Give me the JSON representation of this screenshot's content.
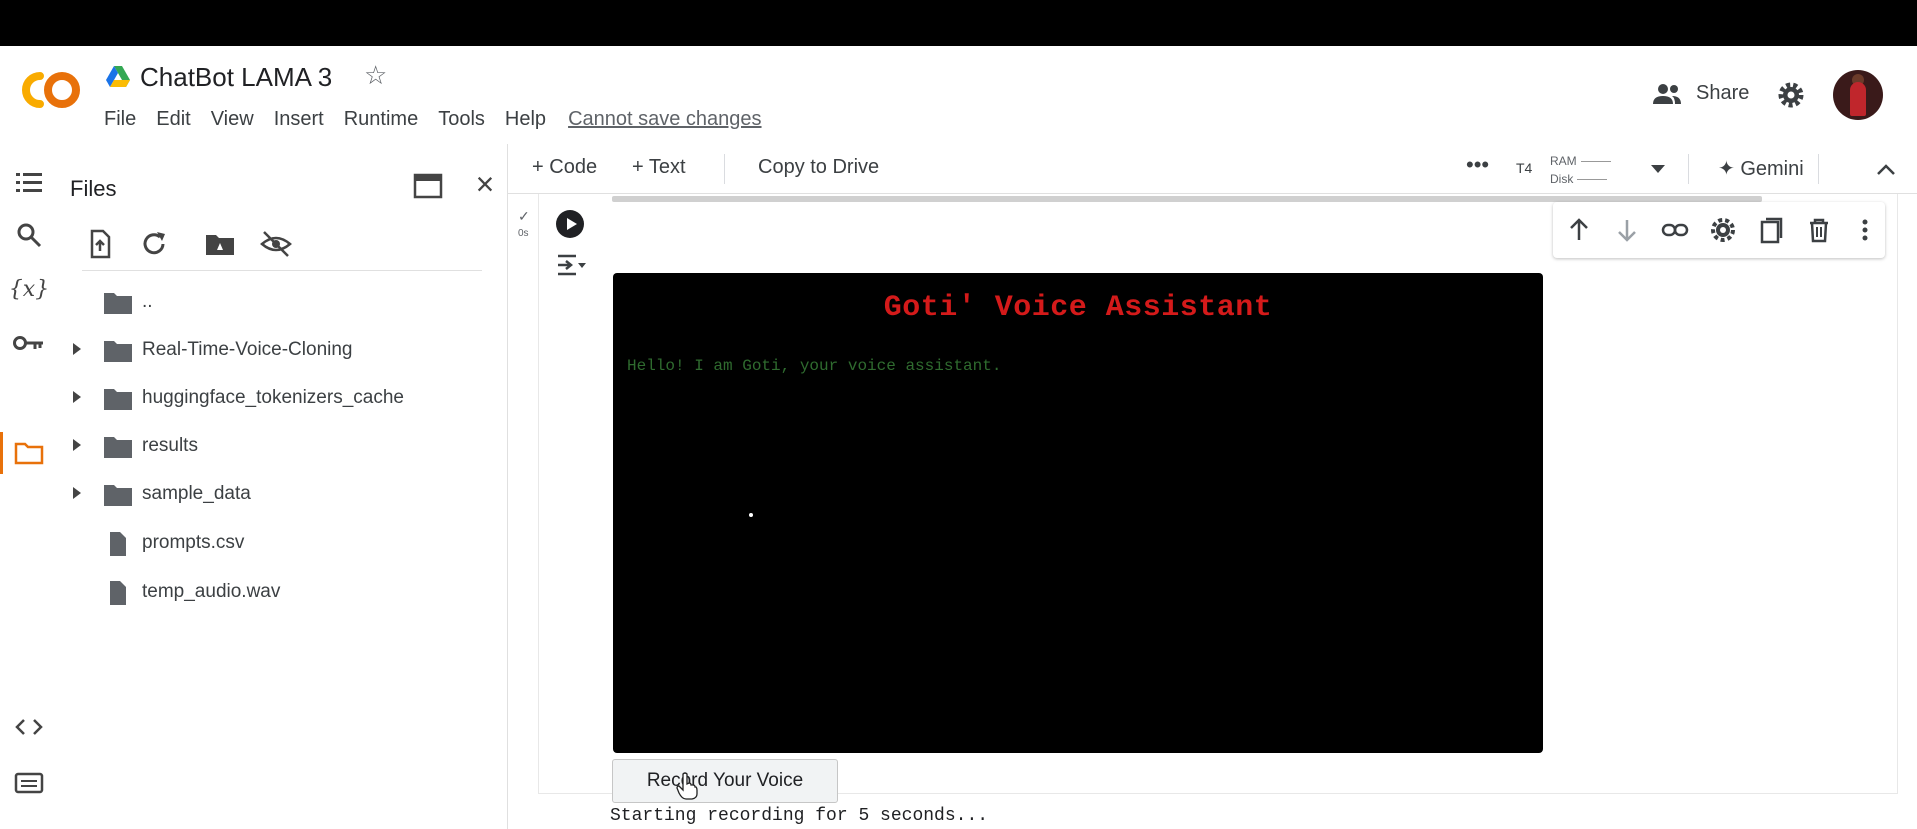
{
  "header": {
    "title": "ChatBot LAMA 3",
    "menu": [
      "File",
      "Edit",
      "View",
      "Insert",
      "Runtime",
      "Tools",
      "Help"
    ],
    "save_note": "Cannot save changes",
    "share_label": "Share"
  },
  "files_panel": {
    "title": "Files",
    "items": [
      {
        "name": "..",
        "type": "folder-up"
      },
      {
        "name": "Real-Time-Voice-Cloning",
        "type": "folder"
      },
      {
        "name": "huggingface_tokenizers_cache",
        "type": "folder"
      },
      {
        "name": "results",
        "type": "folder"
      },
      {
        "name": "sample_data",
        "type": "folder"
      },
      {
        "name": "prompts.csv",
        "type": "file"
      },
      {
        "name": "temp_audio.wav",
        "type": "file"
      }
    ]
  },
  "toolbar": {
    "code_label": "Code",
    "text_label": "Text",
    "copy_label": "Copy to Drive",
    "runtime": "T4",
    "ram_label": "RAM",
    "disk_label": "Disk",
    "gemini_label": "Gemini"
  },
  "cell": {
    "exec_time": "0s",
    "assistant_title": "Goti' Voice Assistant",
    "assistant_message": "Hello! I am Goti, your voice assistant.",
    "record_button": "Record Your Voice",
    "status_text": "Starting recording for 5 seconds..."
  },
  "colors": {
    "brand_orange": "#f9ab00",
    "title_red": "#d41a1a",
    "message_green": "#2f6b2f"
  }
}
